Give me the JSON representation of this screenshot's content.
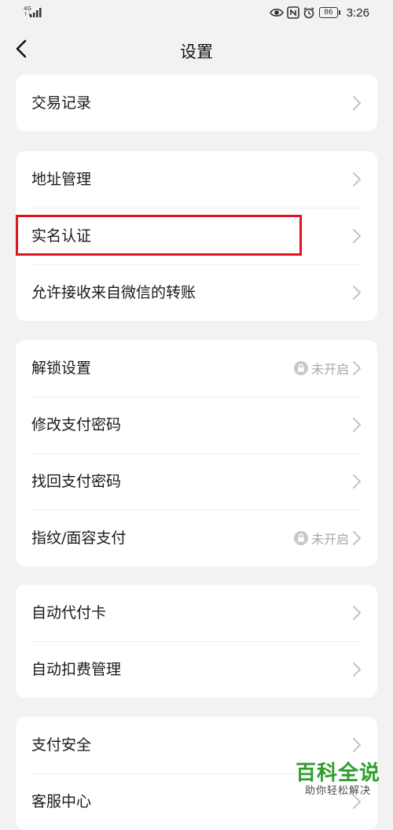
{
  "status_bar": {
    "network": "4G",
    "network_sub": "↑↓",
    "battery": "86",
    "time": "3:26",
    "icons": [
      "signal-icon",
      "eye-icon",
      "nfc-icon",
      "alarm-icon",
      "battery-icon"
    ]
  },
  "header": {
    "title": "设置",
    "back_icon": "chevron-left-icon"
  },
  "groups": [
    {
      "items": [
        {
          "label": "交易记录"
        }
      ]
    },
    {
      "items": [
        {
          "label": "地址管理"
        },
        {
          "label": "实名认证",
          "highlighted": true
        },
        {
          "label": "允许接收来自微信的转账"
        }
      ]
    },
    {
      "items": [
        {
          "label": "解锁设置",
          "status": "未开启",
          "status_icon": "lock-icon"
        },
        {
          "label": "修改支付密码"
        },
        {
          "label": "找回支付密码"
        },
        {
          "label": "指纹/面容支付",
          "status": "未开启",
          "status_icon": "lock-icon"
        }
      ]
    },
    {
      "items": [
        {
          "label": "自动代付卡"
        },
        {
          "label": "自动扣费管理"
        }
      ]
    },
    {
      "items": [
        {
          "label": "支付安全"
        },
        {
          "label": "客服中心"
        }
      ]
    }
  ],
  "colors": {
    "background": "#f2f2f2",
    "card": "#ffffff",
    "highlight": "#e0141e",
    "muted": "#a8a8a8",
    "watermark": "#2e9e2e"
  },
  "watermark": {
    "title": "百科全说",
    "subtitle": "助你轻松解决"
  }
}
